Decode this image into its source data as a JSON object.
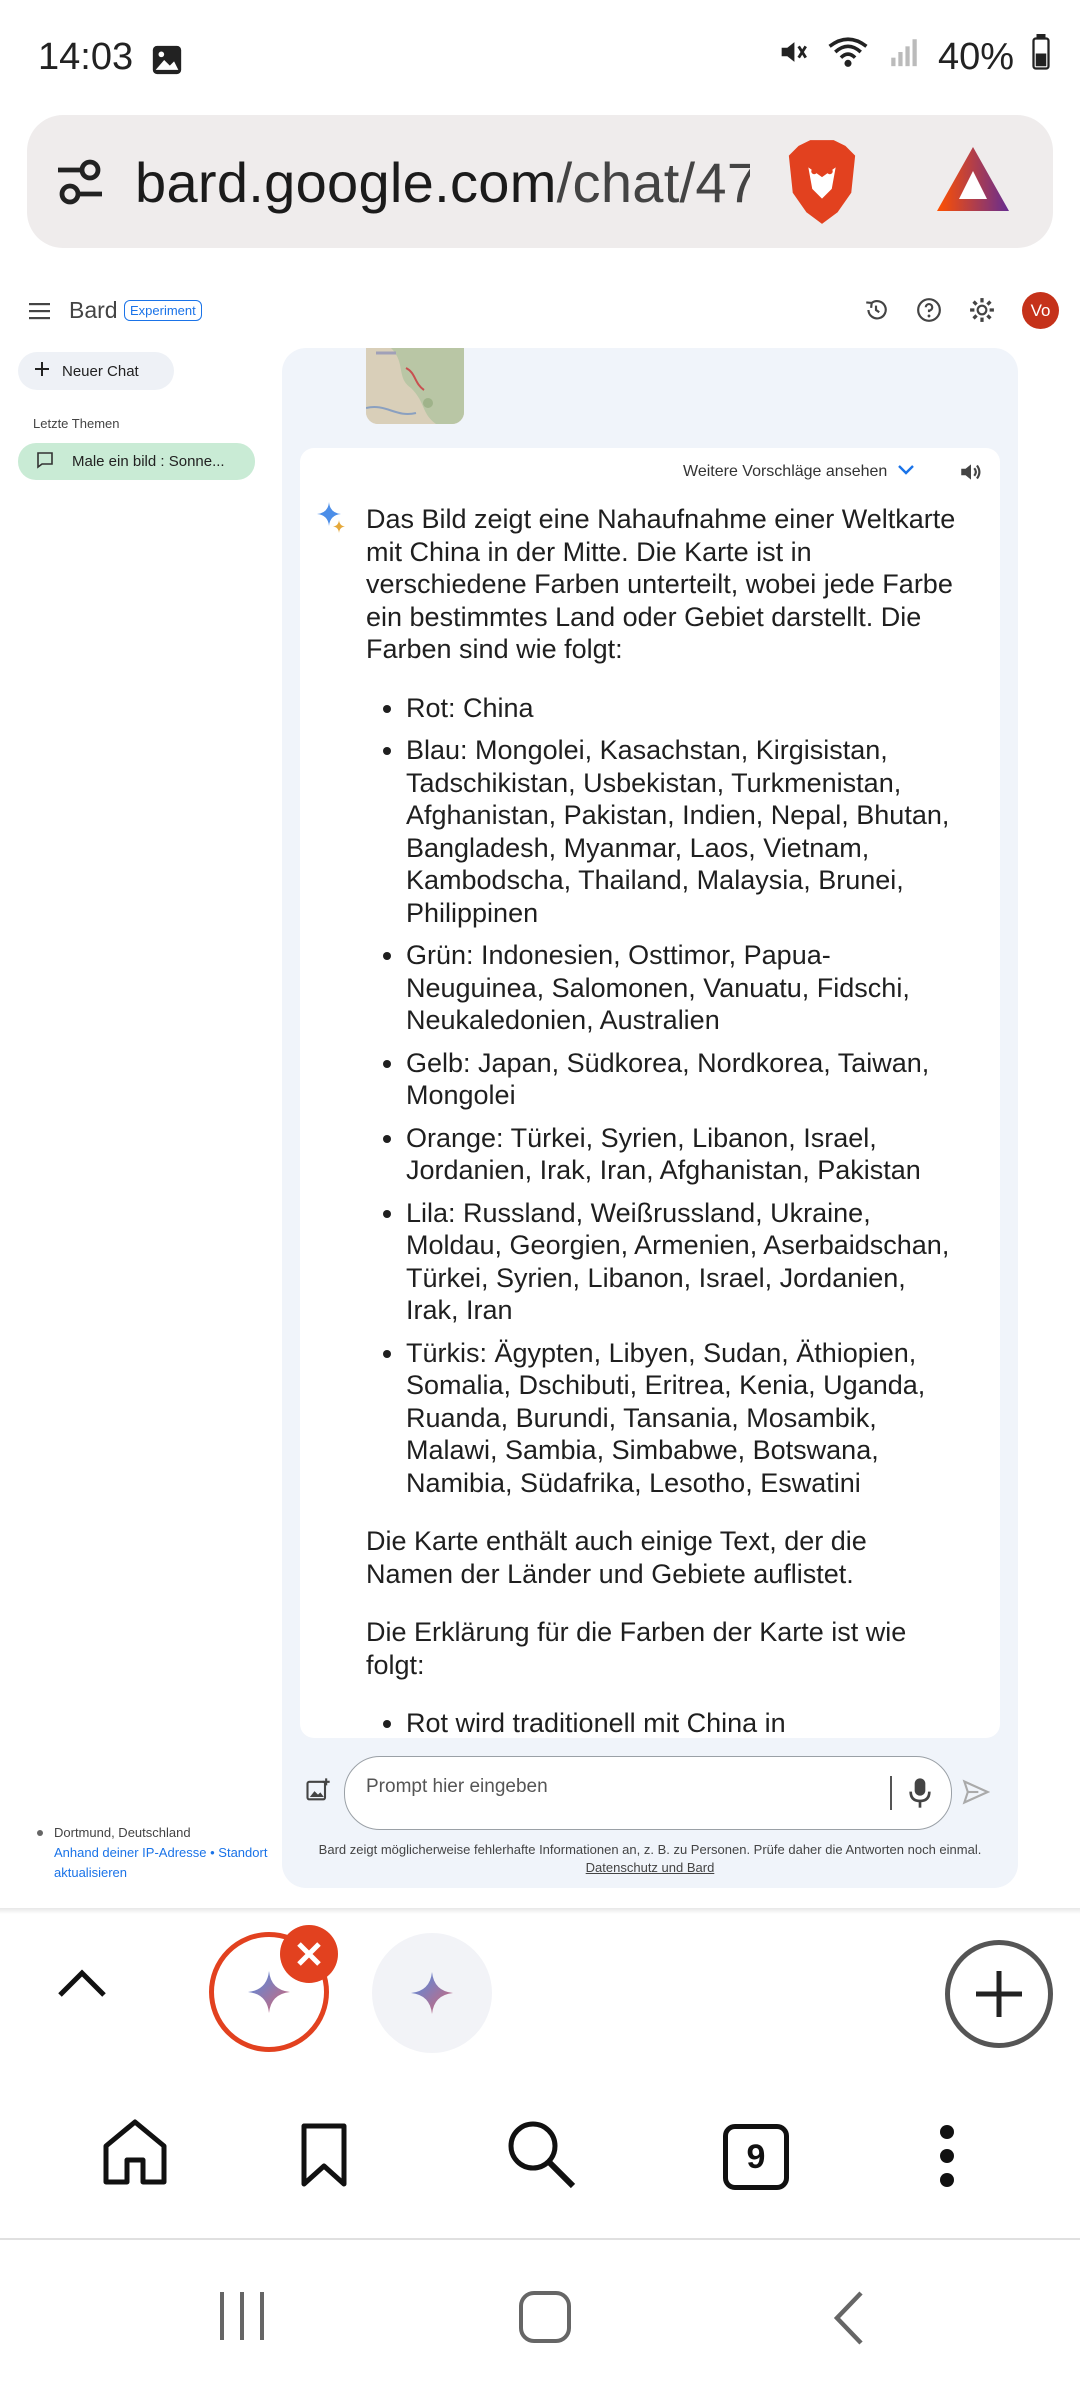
{
  "status_bar": {
    "time": "14:03",
    "battery": "40%"
  },
  "browser": {
    "url_domain": "bard.google.com",
    "url_path": "/chat/47",
    "tab_count": "9"
  },
  "sidebar": {
    "app_name": "Bard",
    "badge": "Experiment",
    "new_chat_label": "Neuer Chat",
    "recent_label": "Letzte Themen",
    "recent_items": [
      {
        "label": "Male ein bild : Sonne..."
      }
    ],
    "location": {
      "city": "Dortmund, Deutschland",
      "source_link": "Anhand deiner IP-Adresse",
      "separator": "•",
      "update_link_1": "Standort",
      "update_link_2": "aktualisieren"
    }
  },
  "response": {
    "more_drafts_label": "Weitere Vorschläge ansehen",
    "intro": "Das Bild zeigt eine Nahaufnahme einer Weltkarte mit China in der Mitte. Die Karte ist in verschiedene Farben unterteilt, wobei jede Farbe ein bestimmtes Land oder Gebiet darstellt. Die Farben sind wie folgt:",
    "colors": [
      "Rot: China",
      "Blau: Mongolei, Kasachstan, Kirgisistan, Tadschikistan, Usbekistan, Turkmenistan, Afghanistan, Pakistan, Indien, Nepal, Bhutan, Bangladesh, Myanmar, Laos, Vietnam, Kambodscha, Thailand, Malaysia, Brunei, Philippinen",
      "Grün: Indonesien, Osttimor, Papua-Neuguinea, Salomonen, Vanuatu, Fidschi, Neukaledonien, Australien",
      "Gelb: Japan, Südkorea, Nordkorea, Taiwan, Mongolei",
      "Orange: Türkei, Syrien, Libanon, Israel, Jordanien, Irak, Iran, Afghanistan, Pakistan",
      "Lila: Russland, Weißrussland, Ukraine, Moldau, Georgien, Armenien, Aserbaidschan, Türkei, Syrien, Libanon, Israel, Jordanien, Irak, Iran",
      "Türkis: Ägypten, Libyen, Sudan, Äthiopien, Somalia, Dschibuti, Eritrea, Kenia, Uganda, Ruanda, Burundi, Tansania, Mosambik, Malawi, Sambia, Simbabwe, Botswana, Namibia, Südafrika, Lesotho, Eswatini"
    ],
    "para2": "Die Karte enthält auch einige Text, der die Namen der Länder und Gebiete auflistet.",
    "para3": "Die Erklärung für die Farben der Karte ist wie folgt:",
    "explanations": [
      "Rot wird traditionell mit China in"
    ]
  },
  "input": {
    "placeholder": "Prompt hier eingeben",
    "disclaimer": "Bard zeigt möglicherweise fehlerhafte Informationen an, z. B. zu Personen. Prüfe daher die Antworten noch einmal.",
    "privacy_link": "Datenschutz und Bard"
  },
  "user": {
    "initials": "Vo"
  },
  "colors": {
    "accent_blue": "#1a73e8",
    "avatar": "#c5321a",
    "brave_orange": "#e2411f",
    "recent_item_bg": "#c9ebd5",
    "chat_bg": "#f0f4fa"
  }
}
